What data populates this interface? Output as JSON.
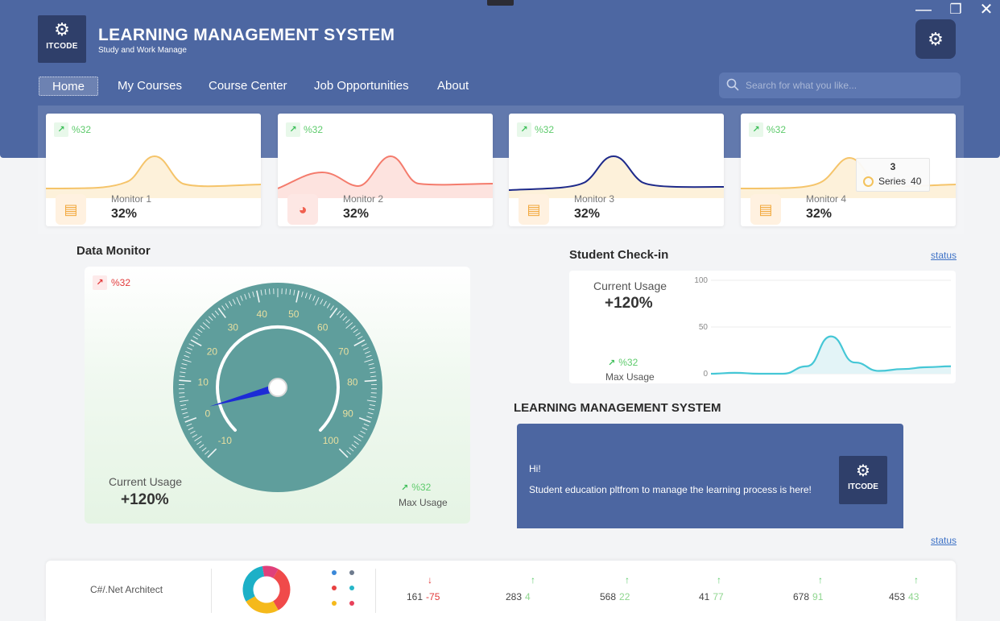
{
  "app": {
    "title": "LEARNING MANAGEMENT SYSTEM",
    "subtitle": "Study and Work Manage",
    "logo_text": "ITCODE"
  },
  "window_controls": {
    "minimize": "—",
    "restore": "❐",
    "close": "✕"
  },
  "nav": [
    {
      "label": "Home",
      "active": true
    },
    {
      "label": "My Courses"
    },
    {
      "label": "Course Center"
    },
    {
      "label": "Job Opportunities"
    },
    {
      "label": "About"
    }
  ],
  "search": {
    "placeholder": "Search for what you like..."
  },
  "monitors": [
    {
      "badge": "%32",
      "label": "Monitor 1",
      "value": "32%",
      "icon": "monitor-icon",
      "color": "#f5c46a"
    },
    {
      "badge": "%32",
      "label": "Monitor 2",
      "value": "32%",
      "icon": "pie-chart-icon",
      "color": "#f47b6c"
    },
    {
      "badge": "%32",
      "label": "Monitor 3",
      "value": "32%",
      "icon": "monitor-icon",
      "color": "#1e2a8a"
    },
    {
      "badge": "%32",
      "label": "Monitor 4",
      "value": "32%",
      "icon": "monitor-icon",
      "color": "#f5c46a"
    }
  ],
  "tooltip": {
    "title": "3",
    "series": "Series",
    "value": "40"
  },
  "data_monitor": {
    "title": "Data Monitor",
    "badge": "%32",
    "current_usage_label": "Current Usage",
    "current_usage_value": "+120%",
    "max_badge": "%32",
    "max_usage_label": "Max Usage",
    "gauge": {
      "min": -10,
      "max": 100,
      "value": 2,
      "ticks": [
        "-10",
        "0",
        "10",
        "20",
        "30",
        "40",
        "50",
        "60",
        "70",
        "80",
        "90",
        "100"
      ]
    }
  },
  "check_in": {
    "title": "Student Check-in",
    "status": "status",
    "current_usage_label": "Current Usage",
    "current_usage_value": "+120%",
    "max_badge": "%32",
    "max_usage_label": "Max Usage"
  },
  "chart_data": {
    "type": "area",
    "title": "",
    "xlabel": "",
    "ylabel": "",
    "ylim": [
      0,
      100
    ],
    "yticks": [
      "100",
      "50",
      "0"
    ],
    "x": [
      0,
      1,
      2,
      3,
      4,
      5,
      6,
      7,
      8,
      9,
      10
    ],
    "values": [
      0,
      1,
      0,
      0,
      8,
      40,
      12,
      3,
      5,
      7,
      8
    ],
    "grid": true,
    "color": "#45c7d6"
  },
  "lms": {
    "title": "LEARNING MANAGEMENT SYSTEM",
    "greeting": "Hi!",
    "message": "Student education pltfrom to manage the learning process is here!",
    "logo_text": "ITCODE",
    "status": "status"
  },
  "bottom": {
    "label": "C#/.Net Architect",
    "stats": [
      {
        "value": "161",
        "delta": "-75",
        "direction": "down"
      },
      {
        "value": "283",
        "delta": "4",
        "direction": "up"
      },
      {
        "value": "568",
        "delta": "22",
        "direction": "up"
      },
      {
        "value": "41",
        "delta": "77",
        "direction": "up"
      },
      {
        "value": "678",
        "delta": "91",
        "direction": "up"
      },
      {
        "value": "453",
        "delta": "43",
        "direction": "up"
      }
    ],
    "donut_colors": [
      "#f04a4a",
      "#f5b91b",
      "#1cb0c7",
      "#e0407a"
    ],
    "dot_colors": [
      "#3a88d8",
      "#6e7b8d",
      "#e84040",
      "#26b6c8",
      "#f5b91b",
      "#e8405a"
    ]
  }
}
